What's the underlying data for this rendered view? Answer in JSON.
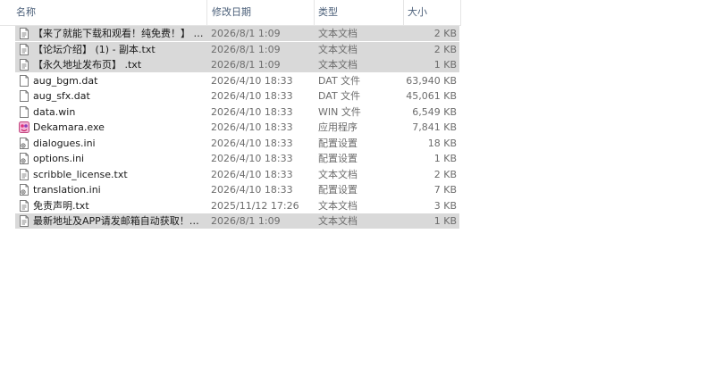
{
  "header": {
    "name": "名称",
    "date": "修改日期",
    "type": "类型",
    "size": "大小",
    "sort_arrow": "^"
  },
  "files": [
    {
      "name": "【来了就能下载和观看！纯免费！】 - 副本.txt",
      "date": "2026/8/1 1:09",
      "type": "文本文档",
      "size": "2 KB",
      "icon": "text-file-icon",
      "selected": true
    },
    {
      "name": "【论坛介绍】 (1) - 副本.txt",
      "date": "2026/8/1 1:09",
      "type": "文本文档",
      "size": "2 KB",
      "icon": "text-file-icon",
      "selected": true
    },
    {
      "name": "【永久地址发布页】 .txt",
      "date": "2026/8/1 1:09",
      "type": "文本文档",
      "size": "1 KB",
      "icon": "text-file-icon",
      "selected": true
    },
    {
      "name": "aug_bgm.dat",
      "date": "2026/4/10 18:33",
      "type": "DAT 文件",
      "size": "63,940 KB",
      "icon": "blank-file-icon",
      "selected": false
    },
    {
      "name": "aug_sfx.dat",
      "date": "2026/4/10 18:33",
      "type": "DAT 文件",
      "size": "45,061 KB",
      "icon": "blank-file-icon",
      "selected": false
    },
    {
      "name": "data.win",
      "date": "2026/4/10 18:33",
      "type": "WIN 文件",
      "size": "6,549 KB",
      "icon": "blank-file-icon",
      "selected": false
    },
    {
      "name": "Dekamara.exe",
      "date": "2026/4/10 18:33",
      "type": "应用程序",
      "size": "7,841 KB",
      "icon": "app-exe-icon",
      "selected": false
    },
    {
      "name": "dialogues.ini",
      "date": "2026/4/10 18:33",
      "type": "配置设置",
      "size": "18 KB",
      "icon": "config-file-icon",
      "selected": false
    },
    {
      "name": "options.ini",
      "date": "2026/4/10 18:33",
      "type": "配置设置",
      "size": "1 KB",
      "icon": "config-file-icon",
      "selected": false
    },
    {
      "name": "scribble_license.txt",
      "date": "2026/4/10 18:33",
      "type": "文本文档",
      "size": "2 KB",
      "icon": "text-file-icon",
      "selected": false
    },
    {
      "name": "translation.ini",
      "date": "2026/4/10 18:33",
      "type": "配置设置",
      "size": "7 KB",
      "icon": "config-file-icon",
      "selected": false
    },
    {
      "name": "免责声明.txt",
      "date": "2025/11/12 17:26",
      "type": "文本文档",
      "size": "3 KB",
      "icon": "text-file-icon",
      "selected": false
    },
    {
      "name": "最新地址及APP请发邮箱自动获取！！！.txt",
      "date": "2026/8/1 1:09",
      "type": "文本文档",
      "size": "1 KB",
      "icon": "text-file-icon",
      "selected": true
    }
  ]
}
